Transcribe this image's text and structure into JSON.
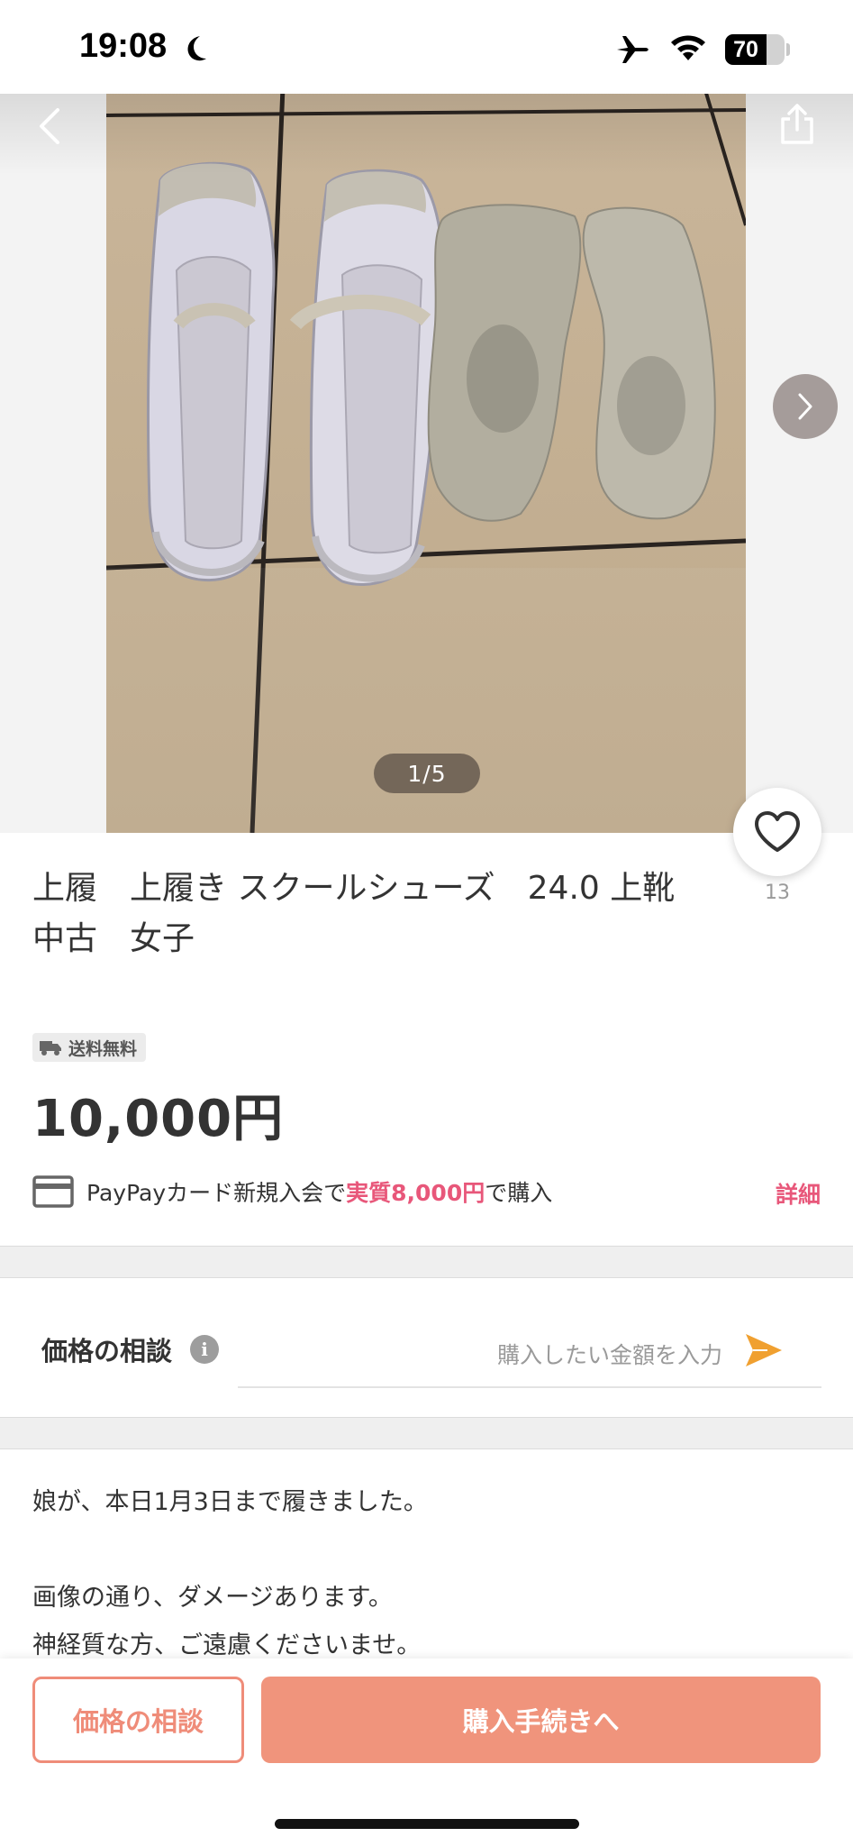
{
  "status_bar": {
    "time": "19:08",
    "battery_level": "70",
    "battery_fraction": 0.7,
    "icons": [
      "moon-icon",
      "airplane-icon",
      "wifi-icon",
      "battery-icon"
    ]
  },
  "nav": {
    "back_icon": "chevron-left-icon",
    "share_icon": "share-icon",
    "next_icon": "chevron-right-icon"
  },
  "photo": {
    "counter": "1/5"
  },
  "like": {
    "count": "13",
    "icon": "heart-icon"
  },
  "item": {
    "title": "上履　上履き スクールシューズ　24.0 上靴\n中古　女子",
    "shipping_badge": "送料無料",
    "price": "10,000円"
  },
  "paypay": {
    "text_before": "PayPayカード新規入会で",
    "highlight": "実質8,000円",
    "text_after": "で購入",
    "detail_link": "詳細"
  },
  "negotiation": {
    "label": "価格の相談",
    "info_icon_glyph": "i",
    "placeholder": "購入したい金額を入力"
  },
  "description": {
    "text": "娘が、本日1月3日まで履きました。\n\n画像の通り、ダメージあります。\n神経質な方、ご遠慮くださいませ。"
  },
  "bottom_bar": {
    "negotiate_label": "価格の相談",
    "buy_label": "購入手続きへ"
  },
  "colors": {
    "accent_pink": "#e8577a",
    "button_salmon": "#f0947c",
    "send_orange": "#f0a030"
  }
}
